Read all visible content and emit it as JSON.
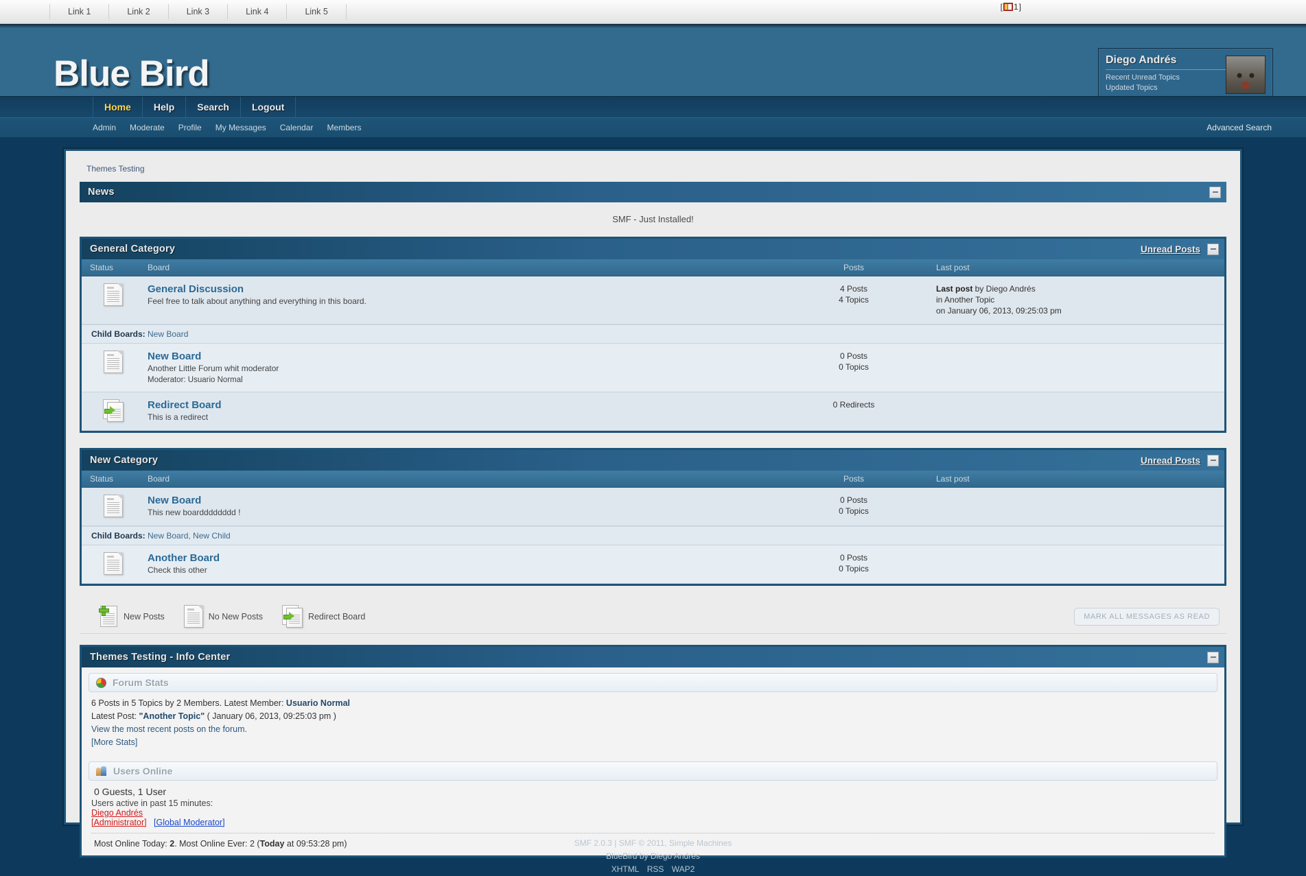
{
  "top_links": [
    "Link 1",
    "Link 2",
    "Link 3",
    "Link 4",
    "Link 5"
  ],
  "pm_indicator": {
    "open": "[",
    "count": "1",
    "close": "]",
    "icon": "message-flag-icon"
  },
  "header": {
    "forum_title": "Blue Bird",
    "user": {
      "name": "Diego Andrés",
      "links": [
        "Recent Unread Topics",
        "Updated Topics"
      ],
      "avatar_alt": "wolf-avatar"
    }
  },
  "main_menu": [
    "Home",
    "Help",
    "Search",
    "Logout"
  ],
  "sub_menu": [
    "Admin",
    "Moderate",
    "Profile",
    "My Messages",
    "Calendar",
    "Members"
  ],
  "advanced_search": "Advanced Search",
  "breadcrumb": "Themes Testing",
  "news": {
    "title": "News",
    "body": "SMF - Just Installed!"
  },
  "columns": {
    "status": "Status",
    "board": "Board",
    "posts": "Posts",
    "last_post": "Last post"
  },
  "unread_posts_label": "Unread Posts",
  "categories": [
    {
      "title": "General Category",
      "rows": [
        {
          "type": "board",
          "icon": "board-off-icon",
          "name": "General Discussion",
          "desc": "Feel free to talk about anything and everything in this board.",
          "moderator": "",
          "posts": "4 Posts",
          "topics": "4 Topics",
          "lastpost_prefix": "Last post",
          "lastpost_by": " by Diego Andrés",
          "lastpost_in": "in Another Topic",
          "lastpost_on": "on January 06, 2013, 09:25:03 pm"
        },
        {
          "type": "children",
          "label": "Child Boards:",
          "items": "New Board"
        },
        {
          "type": "board",
          "icon": "board-off-icon",
          "name": "New Board",
          "desc": "Another Little Forum whit moderator",
          "moderator": "Moderator: Usuario Normal",
          "posts": "0 Posts",
          "topics": "0 Topics",
          "lastpost_prefix": "",
          "lastpost_by": "",
          "lastpost_in": "",
          "lastpost_on": ""
        },
        {
          "type": "redirect",
          "icon": "board-redirect-icon",
          "name": "Redirect Board",
          "desc": "This is a redirect",
          "moderator": "",
          "posts": "0 Redirects",
          "topics": "",
          "lastpost_prefix": "",
          "lastpost_by": "",
          "lastpost_in": "",
          "lastpost_on": ""
        }
      ]
    },
    {
      "title": "New Category",
      "rows": [
        {
          "type": "board",
          "icon": "board-off-icon",
          "name": "New Board",
          "desc": "This new boardddddddd !",
          "moderator": "",
          "posts": "0 Posts",
          "topics": "0 Topics",
          "lastpost_prefix": "",
          "lastpost_by": "",
          "lastpost_in": "",
          "lastpost_on": ""
        },
        {
          "type": "children",
          "label": "Child Boards:",
          "items": "New Board, New Child"
        },
        {
          "type": "board",
          "icon": "board-off-icon",
          "name": "Another Board",
          "desc": "Check this other",
          "moderator": "",
          "posts": "0 Posts",
          "topics": "0 Topics",
          "lastpost_prefix": "",
          "lastpost_by": "",
          "lastpost_in": "",
          "lastpost_on": ""
        }
      ]
    }
  ],
  "legend": [
    {
      "icon": "new-posts-icon",
      "label": "New Posts"
    },
    {
      "icon": "no-new-posts-icon",
      "label": "No New Posts"
    },
    {
      "icon": "redirect-board-icon",
      "label": "Redirect Board"
    }
  ],
  "mark_all_read": "MARK ALL MESSAGES AS READ",
  "info_center": {
    "title": "Themes Testing - Info Center",
    "forum_stats": {
      "heading": "Forum Stats",
      "line1_a": "6 Posts in 5 Topics by 2 Members. Latest Member: ",
      "line1_b": "Usuario Normal",
      "line2_a": "Latest Post: ",
      "line2_b": "\"Another Topic\"",
      "line2_c": " ( January 06, 2013, 09:25:03 pm )",
      "line3": "View the most recent posts on the forum.",
      "line4": "[More Stats]"
    },
    "users_online": {
      "heading": "Users Online",
      "summary": "0 Guests, 1 User",
      "active_note": "Users active in past 15 minutes:",
      "user_name": "Diego Andrés",
      "group_admin": "[Administrator]",
      "group_gmod": "[Global Moderator]",
      "most_online_a": "Most Online Today: ",
      "most_online_b": "2",
      "most_online_c": ". Most Online Ever: 2 (",
      "most_online_d": "Today",
      "most_online_e": " at 09:53:28 pm)"
    }
  },
  "footer": {
    "line1": "SMF 2.0.3 | SMF © 2011, Simple Machines",
    "line2": "BlueBird by Diego Andrés",
    "valid_links": [
      "XHTML",
      "RSS",
      "WAP2"
    ]
  },
  "colors": {
    "page_bg": "#0d3a5c",
    "banner": "#336b8e",
    "cat_bar": "#2a5b80",
    "menu_active": "#ffd84d",
    "board_link": "#2a6a96"
  }
}
